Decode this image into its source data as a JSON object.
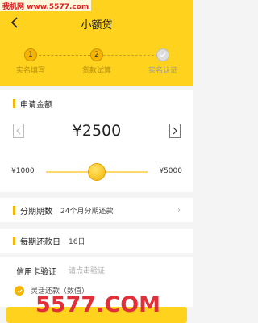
{
  "watermark_top": "我机网 www.5577.com",
  "watermark_big": "5577.COM",
  "header": {
    "title": "小额贷"
  },
  "steps": [
    {
      "num": "1",
      "label": "实名填写",
      "state": "done"
    },
    {
      "num": "2",
      "label": "贷款试算",
      "state": "done"
    },
    {
      "num": "",
      "label": "实名认证",
      "state": "pending"
    }
  ],
  "apply": {
    "title": "申请金额",
    "amount": "¥2500",
    "min": "¥1000",
    "max": "¥5000",
    "level_percent": 50
  },
  "installments": {
    "label": "分期期数",
    "value": "24个月分期还款"
  },
  "repay_day": {
    "label": "每期还款日",
    "value": "16日"
  },
  "credit_card": {
    "label": "信用卡验证",
    "hint": "请点击验证"
  },
  "flexible": {
    "text": "灵活还款（数值）"
  },
  "colors": {
    "accent": "#ffd21e",
    "watermark": "#e2303a"
  }
}
